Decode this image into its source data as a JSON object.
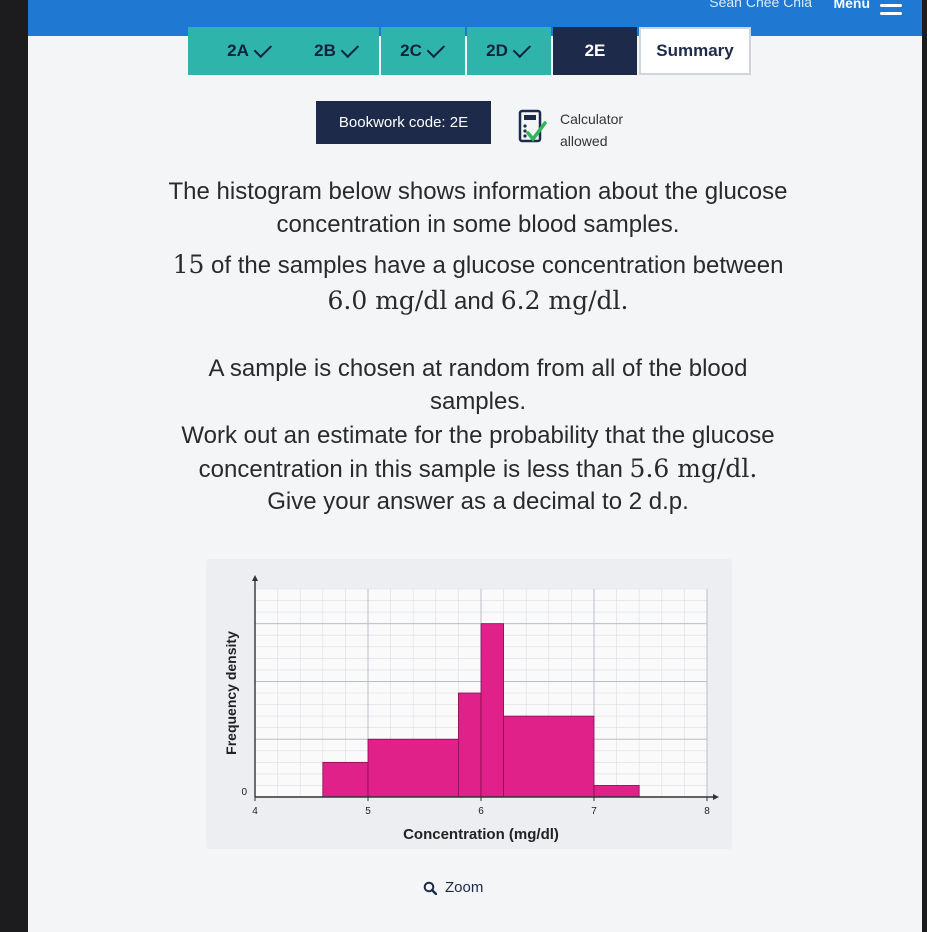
{
  "topbar": {
    "user_name": "Sean Chee Chia",
    "menu_label": "Menu"
  },
  "tabs": [
    {
      "label": "2A",
      "completed": true
    },
    {
      "label": "2B",
      "completed": true
    },
    {
      "label": "2C",
      "completed": true
    },
    {
      "label": "2D",
      "completed": true
    },
    {
      "label": "2E",
      "completed": false,
      "active": true
    },
    {
      "label": "Summary",
      "completed": false
    }
  ],
  "bookwork": {
    "label": "Bookwork code: 2E"
  },
  "calculator": {
    "line1": "Calculator",
    "line2": "allowed",
    "icon": "calculator-check-icon"
  },
  "question": {
    "line1": "The histogram below shows information about the glucose",
    "line2": "concentration in some blood samples.",
    "line3_num": "15",
    "line3_text": " of the samples have a glucose concentration between",
    "line4_a": "6.0 mg/dl",
    "line4_and": " and ",
    "line4_b": "6.2 mg/dl.",
    "line5": "A sample is chosen at random from all of the blood",
    "line6": "samples.",
    "line7": "Work out an estimate for the probability that the glucose",
    "line8_text": "concentration in this sample is less than ",
    "line8_math": "5.6 mg/dl.",
    "line9": "Give your answer as a decimal to 2 d.p."
  },
  "chart_data": {
    "type": "bar",
    "subtype": "histogram",
    "xlabel": "Concentration (mg/dl)",
    "ylabel": "Frequency density",
    "xlim": [
      4,
      8
    ],
    "x_ticks": [
      "4",
      "5",
      "6",
      "7",
      "8"
    ],
    "y_ticks": [
      "0"
    ],
    "grid": true,
    "bar_color": "#e0218a",
    "bins": [
      {
        "from": 4.6,
        "to": 5.0,
        "height": 1.5
      },
      {
        "from": 5.0,
        "to": 5.8,
        "height": 2.5
      },
      {
        "from": 5.8,
        "to": 6.0,
        "height": 4.5
      },
      {
        "from": 6.0,
        "to": 6.2,
        "height": 7.5
      },
      {
        "from": 6.2,
        "to": 7.0,
        "height": 3.5
      },
      {
        "from": 7.0,
        "to": 7.4,
        "height": 0.5
      }
    ]
  },
  "zoom": {
    "label": "Zoom"
  }
}
